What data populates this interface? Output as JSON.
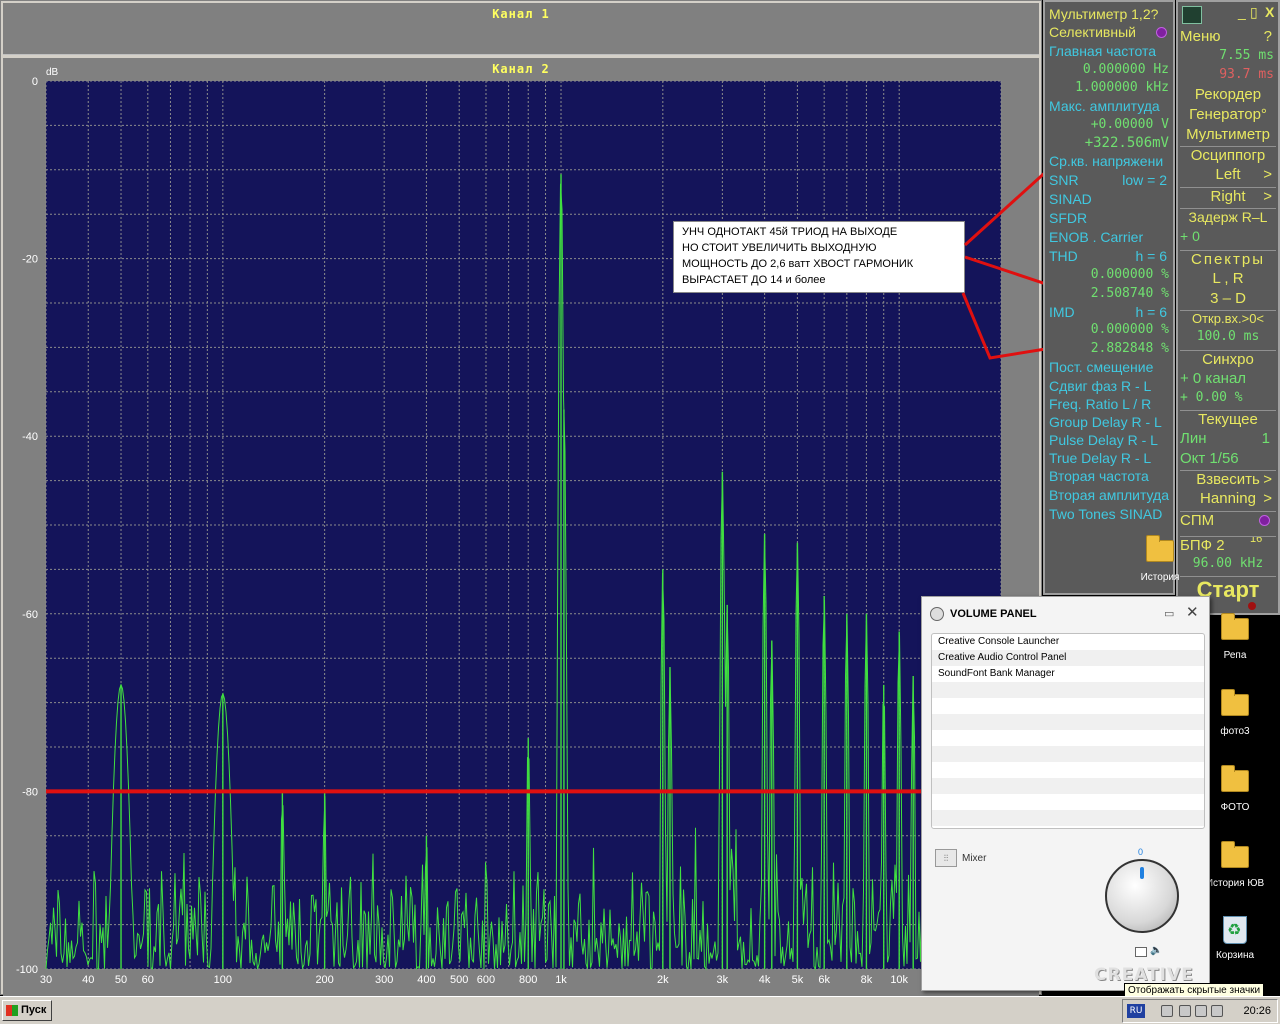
{
  "analyzer": {
    "channel1_title": "Канал 1",
    "channel2_title": "Канал 2",
    "y_unit": "dB"
  },
  "chart_data": {
    "type": "line",
    "xlabel": "",
    "ylabel": "dB",
    "xscale": "log",
    "xlim": [
      30,
      20000
    ],
    "ylim": [
      -100,
      0
    ],
    "grid": true,
    "background_color": "#14145a",
    "line_color": "#40e040",
    "y_ticks": [
      0,
      -20,
      -40,
      -60,
      -80,
      -100
    ],
    "x_ticks": [
      {
        "value": 30,
        "label": "30"
      },
      {
        "value": 40,
        "label": "40"
      },
      {
        "value": 50,
        "label": "50"
      },
      {
        "value": 60,
        "label": "60"
      },
      {
        "value": 100,
        "label": "100"
      },
      {
        "value": 200,
        "label": "200"
      },
      {
        "value": 300,
        "label": "300"
      },
      {
        "value": 400,
        "label": "400"
      },
      {
        "value": 500,
        "label": "500"
      },
      {
        "value": 600,
        "label": "600"
      },
      {
        "value": 800,
        "label": "800"
      },
      {
        "value": 1000,
        "label": "1k"
      },
      {
        "value": 2000,
        "label": "2k"
      },
      {
        "value": 3000,
        "label": "3k"
      },
      {
        "value": 4000,
        "label": "4k"
      },
      {
        "value": 5000,
        "label": "5k"
      },
      {
        "value": 6000,
        "label": "6k"
      },
      {
        "value": 8000,
        "label": "8k"
      },
      {
        "value": 10000,
        "label": "10k"
      }
    ],
    "peaks": [
      {
        "f": 50,
        "db": -68
      },
      {
        "f": 100,
        "db": -69
      },
      {
        "f": 150,
        "db": -80
      },
      {
        "f": 200,
        "db": -80
      },
      {
        "f": 400,
        "db": -85
      },
      {
        "f": 800,
        "db": -74
      },
      {
        "f": 1000,
        "db": -10.5
      },
      {
        "f": 1020,
        "db": -37
      },
      {
        "f": 2000,
        "db": -55
      },
      {
        "f": 2100,
        "db": -66
      },
      {
        "f": 3000,
        "db": -44
      },
      {
        "f": 3100,
        "db": -59
      },
      {
        "f": 4000,
        "db": -51
      },
      {
        "f": 4200,
        "db": -63
      },
      {
        "f": 5000,
        "db": -52
      },
      {
        "f": 6000,
        "db": -58
      },
      {
        "f": 7000,
        "db": -60
      },
      {
        "f": 8000,
        "db": -60
      },
      {
        "f": 9000,
        "db": -68
      },
      {
        "f": 10000,
        "db": -62
      },
      {
        "f": 11000,
        "db": -67
      },
      {
        "f": 12000,
        "db": -69
      },
      {
        "f": 13000,
        "db": -73
      },
      {
        "f": 14000,
        "db": -70
      },
      {
        "f": 15000,
        "db": -80
      }
    ],
    "reference_line": {
      "db": -80,
      "color": "#e01010"
    }
  },
  "annotation": {
    "lines": [
      "УНЧ  ОДНОТАКТ  45й  ТРИОД  НА  ВЫХОДЕ",
      "НО  СТОИТ  УВЕЛИЧИТЬ  ВЫХОДНУЮ",
      "МОЩНОСТЬ  ДО 2,6 ватт ХВОСТ ГАРМОНИК",
      "ВЫРАСТАЕТ  ДО  14 и более"
    ],
    "arrow_color": "#e01010"
  },
  "multimeter": {
    "title": "Мультиметр 1,2?",
    "selective": "Селективный",
    "main_freq_label": "Главная частота",
    "freq_hz": "0.000000  Hz",
    "freq_khz": "1.000000 kHz",
    "max_amp_label": "Макс. амплитуда",
    "amp_v": "+0.00000  V",
    "amp_mv": "+322.506mV",
    "rms_label": "Ср.кв. напряжени",
    "snr": "SNR",
    "snr_low": "low =  2",
    "sinad": "SINAD",
    "sfdr": "SFDR",
    "enob": "ENOB . Carrier",
    "thd": "THD",
    "thd_h": "h =   6",
    "thd_v1": "0.000000 %",
    "thd_v2": "2.508740 %",
    "imd": "IMD",
    "imd_h": "h =   6",
    "imd_v1": "0.000000 %",
    "imd_v2": "2.882848 %",
    "dc_offset": "Пост. смещение",
    "phase_shift": "Сдвиг фаз R - L",
    "freq_ratio": "Freq. Ratio  L / R",
    "group_delay": "Group Delay R - L",
    "pulse_delay": "Pulse Delay R - L",
    "true_delay": "True Delay R - L",
    "second_freq": "Вторая частота",
    "second_amp": "Вторая амплитуда",
    "two_tones": "Two Tones SINAD"
  },
  "menu_panel": {
    "menu": "Меню",
    "help": "?",
    "min_btn": "_",
    "max_btn": "▯",
    "close_btn": "X",
    "time1": "7.55 ms",
    "time2": "93.7 ms",
    "recorder": "Рекордер",
    "generator": "Генератор°",
    "multimeter": "Мультиметр",
    "oscilloscope": "Осциппогр",
    "left": "Left",
    "right": "Right",
    "arrow": ">",
    "delay": "Задерж  R–L",
    "delay_val": "+      0",
    "spectra": "Спектры",
    "lr": "L , R",
    "three_d": "3 – D",
    "open_input": "Откр.вх.>0<",
    "period": "100.0 ms",
    "sync": "Синхро",
    "sync_channel": "+ 0 канал",
    "sync_percent": "+  0.00 %",
    "current": "Текущее",
    "lin": "Лин",
    "lin_val": "1",
    "oct": "Окт  1/56",
    "weigh": "Взвесить",
    "hanning": "Hanning",
    "spm": "СПМ",
    "fft": "БПФ  2",
    "fft_exp": "16",
    "sample_rate": "96.00 kHz",
    "start": "Старт"
  },
  "desktop": {
    "icons": [
      "История",
      "Репа",
      "фото3",
      "ФОТО",
      "История ЮВ",
      "Корзина"
    ]
  },
  "volume_panel": {
    "title": "VOLUME PANEL",
    "items": [
      "Creative Console Launcher",
      "Creative Audio Control Panel",
      "SoundFont Bank Manager"
    ],
    "mixer": "Mixer",
    "knob_value": "0",
    "brand": "CREATIVE"
  },
  "taskbar": {
    "start": "Пуск",
    "lang": "RU",
    "clock": "20:26",
    "tooltip": "Отображать скрытые значки"
  }
}
